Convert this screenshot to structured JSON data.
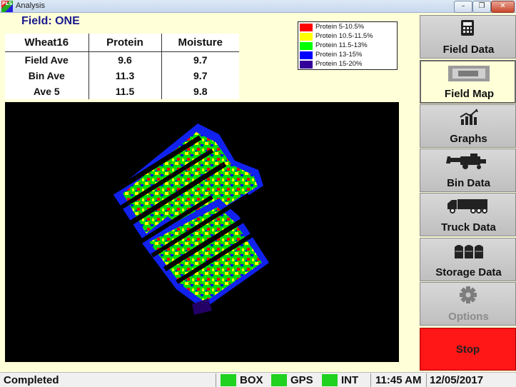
{
  "window": {
    "title": "Analysis",
    "app_icon_text": "PLS",
    "min": "–",
    "max": "❐",
    "close": "✕"
  },
  "field": {
    "label": "Field: ONE"
  },
  "stats": {
    "headers": [
      "Wheat16",
      "Protein",
      "Moisture"
    ],
    "rows": [
      [
        "Field Ave",
        "9.6",
        "9.7"
      ],
      [
        "Bin Ave",
        "11.3",
        "9.7"
      ],
      [
        "Ave 5",
        "11.5",
        "9.8"
      ]
    ]
  },
  "legend": [
    {
      "label": "Protein 5-10.5%",
      "color": "#ff0000"
    },
    {
      "label": "Protein 10.5-11.5%",
      "color": "#ffff00"
    },
    {
      "label": "Protein 11.5-13%",
      "color": "#00ff00"
    },
    {
      "label": "Protein 13-15%",
      "color": "#0000ff"
    },
    {
      "label": "Protein 15-20%",
      "color": "#330099"
    }
  ],
  "nav": [
    {
      "label": "Field Data",
      "icon": "calculator-icon",
      "active": false,
      "enabled": true
    },
    {
      "label": "Field Map",
      "icon": "field-map-thumbnail",
      "active": true,
      "enabled": true
    },
    {
      "label": "Graphs",
      "icon": "bar-chart-icon",
      "active": false,
      "enabled": true
    },
    {
      "label": "Bin Data",
      "icon": "combine-harvester-icon",
      "active": false,
      "enabled": true
    },
    {
      "label": "Truck Data",
      "icon": "truck-icon",
      "active": false,
      "enabled": true
    },
    {
      "label": "Storage Data",
      "icon": "grain-bins-icon",
      "active": false,
      "enabled": true
    },
    {
      "label": "Options",
      "icon": "gear-icon",
      "active": false,
      "enabled": false
    }
  ],
  "stop": {
    "label": "Stop",
    "color": "#ff1616"
  },
  "status": {
    "text": "Completed",
    "indicators": [
      {
        "label": "BOX",
        "color": "#1fd21f"
      },
      {
        "label": "GPS",
        "color": "#1fd21f"
      },
      {
        "label": "INT",
        "color": "#1fd21f"
      }
    ],
    "time": "11:45 AM",
    "date": "12/05/2017"
  }
}
